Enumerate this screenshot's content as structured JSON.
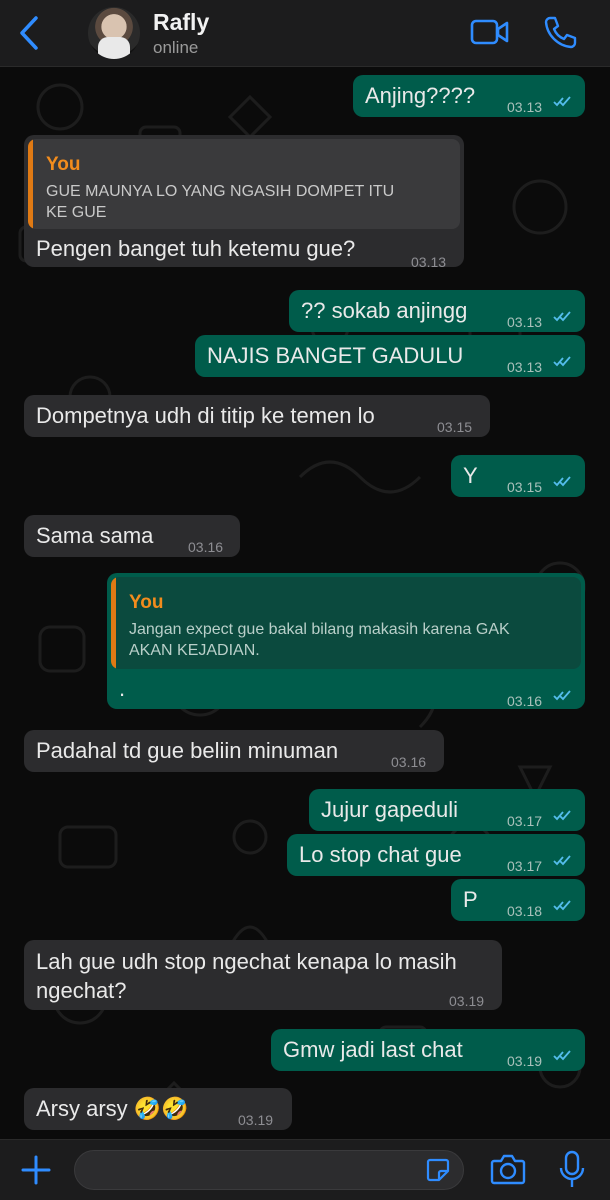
{
  "header": {
    "contact_name": "Rafly",
    "status": "online"
  },
  "messages": [
    {
      "id": "m1",
      "dir": "out",
      "text": "Anjing????",
      "time": "03.13"
    },
    {
      "id": "m2",
      "dir": "in",
      "quote_from": "You",
      "quote_text": "GUE MAUNYA LO YANG NGASIH DOMPET ITU\nKE GUE",
      "text": "Pengen banget tuh ketemu gue?",
      "time": "03.13"
    },
    {
      "id": "m3",
      "dir": "out",
      "text": "?? sokab anjingg",
      "time": "03.13"
    },
    {
      "id": "m4",
      "dir": "out",
      "text": "NAJIS BANGET GADULU",
      "time": "03.13"
    },
    {
      "id": "m5",
      "dir": "in",
      "text": "Dompetnya udh di titip ke temen lo",
      "time": "03.15"
    },
    {
      "id": "m6",
      "dir": "out",
      "text": "Y",
      "time": "03.15"
    },
    {
      "id": "m7",
      "dir": "in",
      "text": "Sama sama",
      "time": "03.16"
    },
    {
      "id": "m8",
      "dir": "out",
      "quote_from": "You",
      "quote_text": "Jangan expect gue bakal bilang makasih karena GAK\nAKAN KEJADIAN.",
      "text": ".",
      "time": "03.16"
    },
    {
      "id": "m9",
      "dir": "in",
      "text": "Padahal td gue beliin minuman",
      "time": "03.16"
    },
    {
      "id": "m10",
      "dir": "out",
      "text": "Jujur gapeduli",
      "time": "03.17"
    },
    {
      "id": "m11",
      "dir": "out",
      "text": "Lo stop chat gue",
      "time": "03.17"
    },
    {
      "id": "m12",
      "dir": "out",
      "text": "P",
      "time": "03.18"
    },
    {
      "id": "m13",
      "dir": "in",
      "text": "Lah gue udh stop ngechat kenapa lo masih\nngechat?",
      "time": "03.19"
    },
    {
      "id": "m14",
      "dir": "out",
      "text": "Gmw jadi last chat",
      "time": "03.19"
    },
    {
      "id": "m15",
      "dir": "in",
      "text": "Arsy arsy 🤣🤣",
      "time": "03.19"
    }
  ],
  "composer": {
    "value": ""
  },
  "icons": {
    "back": "chevron-left-icon",
    "video": "video-camera-icon",
    "call": "phone-icon",
    "add": "plus-icon",
    "sticker": "sticker-icon",
    "camera": "camera-icon",
    "mic": "microphone-icon"
  },
  "colors": {
    "accent": "#2f8cff",
    "outgoing_bubble": "#005c4b",
    "incoming_bubble": "#2c2c2e",
    "read_ticks": "#53bdeb",
    "quote_sender": "#f28c1d"
  }
}
